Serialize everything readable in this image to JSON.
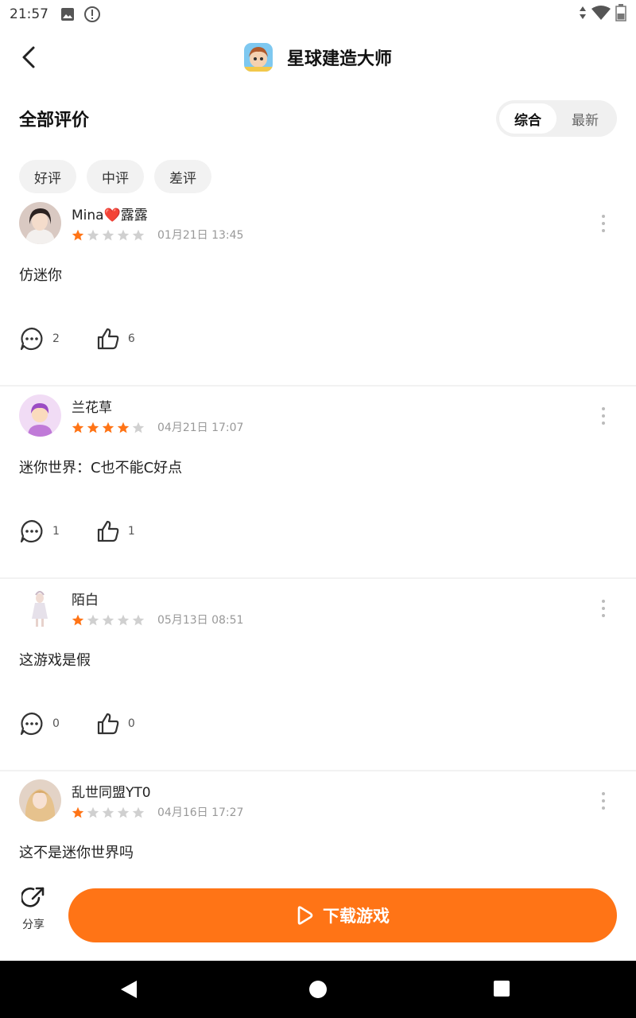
{
  "status_bar": {
    "time": "21:57"
  },
  "header": {
    "title": "星球建造大师",
    "app_icon": "game-app-icon"
  },
  "section": {
    "title": "全部评价"
  },
  "sort": {
    "options": [
      "综合",
      "最新"
    ],
    "selected": "综合"
  },
  "filters": [
    "好评",
    "中评",
    "差评"
  ],
  "reviews": [
    {
      "user": "Mina‍❤️露露‍",
      "rating": 1,
      "time": "01月21日 13:45",
      "text": "仿迷你",
      "comments": "2",
      "likes": "6"
    },
    {
      "user": "兰花草",
      "rating": 4,
      "time": "04月21日 17:07",
      "text": "迷你世界：C也不能C好点",
      "comments": "1",
      "likes": "1"
    },
    {
      "user": "陌白",
      "rating": 1,
      "time": "05月13日 08:51",
      "text": "这游戏是假",
      "comments": "0",
      "likes": "0"
    },
    {
      "user": "乱世同盟YT0",
      "rating": 1,
      "time": "04月16日 17:27",
      "text": "这不是迷你世界吗",
      "comments": "",
      "likes": ""
    }
  ],
  "bottom": {
    "share_label": "分享",
    "download_label": "下载游戏"
  },
  "colors": {
    "accent": "#ff7416",
    "star_on": "#ff7416",
    "star_off": "#d0d0d0"
  }
}
